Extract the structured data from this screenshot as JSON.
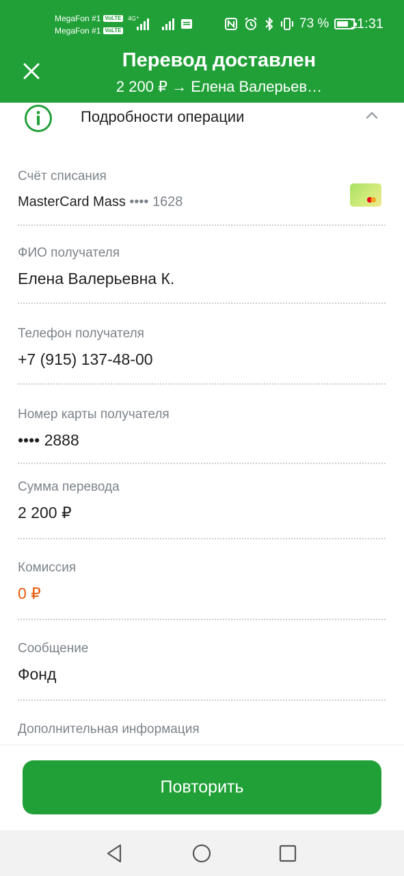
{
  "status_bar": {
    "carrier1": "MegaFon #1",
    "carrier2": "MegaFon #1",
    "volte": "VoLTE",
    "net_type": "4G⁺",
    "battery_pct": "73 %",
    "battery_level": 0.73,
    "time": "11:31"
  },
  "header": {
    "title": "Перевод доставлен",
    "subtitle": "2 200 ₽ → Елена Валерьев…"
  },
  "section": {
    "title": "Подробности операции"
  },
  "fields": {
    "account": {
      "label": "Счёт списания",
      "value": "MasterCard Mass",
      "masked": "•••• 1628"
    },
    "name": {
      "label": "ФИО получателя",
      "value": "Елена Валерьевна К."
    },
    "phone": {
      "label": "Телефон получателя",
      "value": "+7 (915) 137-48-00"
    },
    "card": {
      "label": "Номер карты получателя",
      "value": "•••• 2888"
    },
    "amount": {
      "label": "Сумма перевода",
      "value": "2 200 ₽"
    },
    "fee": {
      "label": "Комиссия",
      "value": "0 ₽"
    },
    "message": {
      "label": "Сообщение",
      "value": "Фонд"
    },
    "extra": {
      "label": "Дополнительная информация"
    }
  },
  "actions": {
    "repeat_label": "Повторить"
  },
  "colors": {
    "brand_green": "#21a038",
    "fee_orange": "#e8590c",
    "label_gray": "#7d838a"
  },
  "icons": {
    "close": "close-icon",
    "info": "info-circle-icon",
    "collapse": "chevron-up-icon",
    "card": "mastercard-card-icon",
    "back": "nav-back-icon",
    "home": "nav-home-icon",
    "recents": "nav-recents-icon"
  }
}
